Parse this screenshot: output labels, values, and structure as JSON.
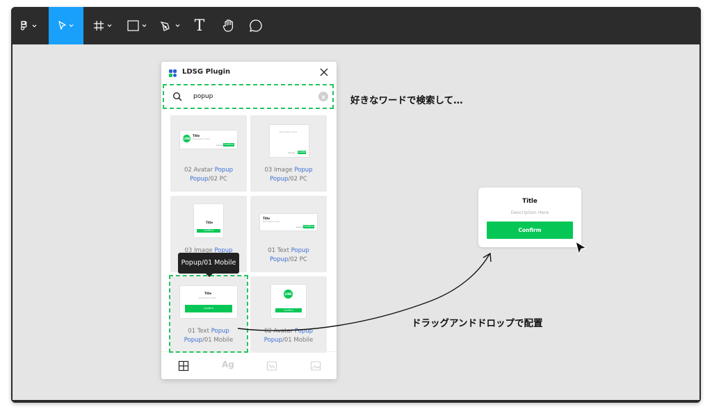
{
  "toolbar": {
    "tools": [
      {
        "name": "figma-menu",
        "icon": "figma-logo-icon",
        "dropdown": true
      },
      {
        "name": "move-tool",
        "icon": "cursor-arrow-icon",
        "dropdown": true,
        "active": true
      },
      {
        "name": "frame-tool",
        "icon": "frame-hash-icon",
        "dropdown": true
      },
      {
        "name": "shape-tool",
        "icon": "rectangle-icon",
        "dropdown": true
      },
      {
        "name": "pen-tool",
        "icon": "pen-icon",
        "dropdown": true
      },
      {
        "name": "text-tool",
        "icon": "text-icon",
        "label": "T"
      },
      {
        "name": "hand-tool",
        "icon": "hand-icon"
      },
      {
        "name": "comment-tool",
        "icon": "comment-bubble-icon"
      }
    ],
    "active_color": "#18a0fb"
  },
  "plugin": {
    "title": "LDSG Plugin",
    "search": {
      "value": "popup",
      "placeholder": ""
    },
    "cards": [
      {
        "line1": "02 Avatar ",
        "hl1": "Popup",
        "hl2": "Popup",
        "rest": "/02 PC"
      },
      {
        "line1": "03 Image ",
        "hl1": "Popup",
        "hl2": "Popup",
        "rest": "/02 PC"
      },
      {
        "line1": "03 Image ",
        "hl1": "Popup",
        "hl2": "",
        "rest": ""
      },
      {
        "line1": "01 Text ",
        "hl1": "Popup",
        "hl2": "Popup",
        "rest": "/02 PC"
      },
      {
        "line1": "01 Text ",
        "hl1": "Popup",
        "hl2": "Popup",
        "rest": "/01 Mobile"
      },
      {
        "line1": "02 Avatar ",
        "hl1": "Popup",
        "hl2": "Popup",
        "rest": "/01 Mobile"
      }
    ],
    "thumb_text": {
      "title": "Title",
      "desc": "Description Here",
      "btn": "Confirm",
      "cancel": "Cancel",
      "avatar": "LINE"
    },
    "tabs": [
      {
        "name": "components-tab",
        "icon": "grid-icon",
        "active": true
      },
      {
        "name": "typography-tab",
        "icon": "text-ag-icon",
        "label": "Ag"
      },
      {
        "name": "icons-tab",
        "icon": "icon-set-icon"
      },
      {
        "name": "images-tab",
        "icon": "image-icon"
      }
    ],
    "tooltip": "Popup/01 Mobile"
  },
  "canvas_popup": {
    "title": "Title",
    "description": "Description Here",
    "button": "Confirm",
    "accent": "#06c755"
  },
  "annotations": {
    "search_note": "好きなワードで検索して…",
    "drag_note": "ドラッグアンドドロップで配置"
  }
}
